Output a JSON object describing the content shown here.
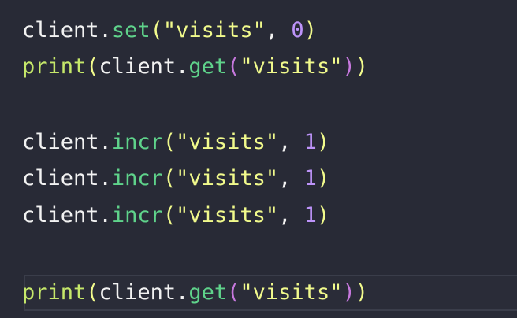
{
  "lines": [
    {
      "tokens": [
        "client",
        ".",
        "set",
        "(",
        "\"visits\"",
        ", ",
        "0",
        ")"
      ]
    },
    {
      "tokens": [
        "print",
        "(",
        "client",
        ".",
        "get",
        "(",
        "\"visits\"",
        ")",
        ")"
      ]
    },
    {
      "tokens": []
    },
    {
      "tokens": [
        "client",
        ".",
        "incr",
        "(",
        "\"visits\"",
        ", ",
        "1",
        ")"
      ]
    },
    {
      "tokens": [
        "client",
        ".",
        "incr",
        "(",
        "\"visits\"",
        ", ",
        "1",
        ")"
      ]
    },
    {
      "tokens": [
        "client",
        ".",
        "incr",
        "(",
        "\"visits\"",
        ", ",
        "1",
        ")"
      ]
    },
    {
      "tokens": []
    },
    {
      "tokens": [
        "print",
        "(",
        "client",
        ".",
        "get",
        "(",
        "\"visits\"",
        ")",
        ")"
      ]
    }
  ],
  "colors": {
    "background": "#282a36",
    "identifier": "#f2f2f2",
    "method": "#5fd38b",
    "builtin": "#c6e86a",
    "string": "#f1fa8c",
    "number": "#bd93f9",
    "paren_inner": "#c678dd"
  }
}
